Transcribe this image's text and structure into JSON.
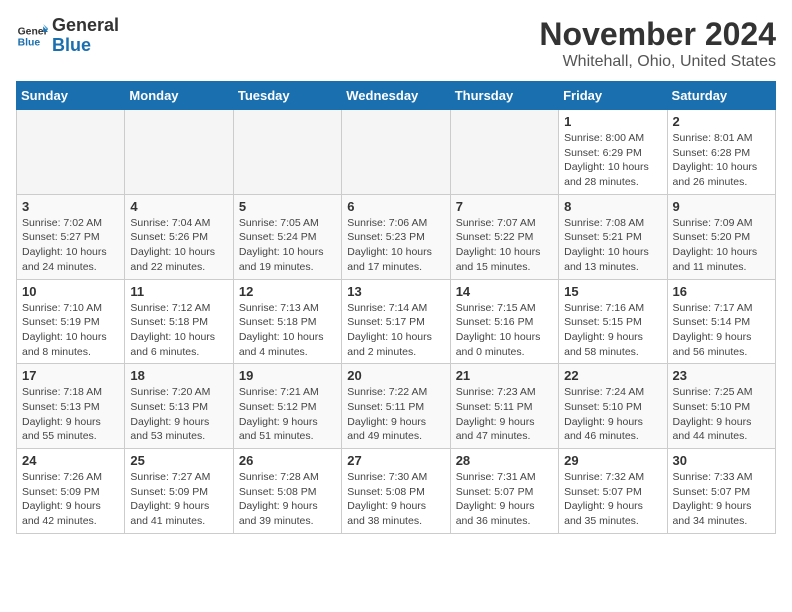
{
  "header": {
    "logo_general": "General",
    "logo_blue": "Blue",
    "month_title": "November 2024",
    "location": "Whitehall, Ohio, United States"
  },
  "weekdays": [
    "Sunday",
    "Monday",
    "Tuesday",
    "Wednesday",
    "Thursday",
    "Friday",
    "Saturday"
  ],
  "weeks": [
    [
      {
        "day": "",
        "info": ""
      },
      {
        "day": "",
        "info": ""
      },
      {
        "day": "",
        "info": ""
      },
      {
        "day": "",
        "info": ""
      },
      {
        "day": "",
        "info": ""
      },
      {
        "day": "1",
        "info": "Sunrise: 8:00 AM\nSunset: 6:29 PM\nDaylight: 10 hours and 28 minutes."
      },
      {
        "day": "2",
        "info": "Sunrise: 8:01 AM\nSunset: 6:28 PM\nDaylight: 10 hours and 26 minutes."
      }
    ],
    [
      {
        "day": "3",
        "info": "Sunrise: 7:02 AM\nSunset: 5:27 PM\nDaylight: 10 hours and 24 minutes."
      },
      {
        "day": "4",
        "info": "Sunrise: 7:04 AM\nSunset: 5:26 PM\nDaylight: 10 hours and 22 minutes."
      },
      {
        "day": "5",
        "info": "Sunrise: 7:05 AM\nSunset: 5:24 PM\nDaylight: 10 hours and 19 minutes."
      },
      {
        "day": "6",
        "info": "Sunrise: 7:06 AM\nSunset: 5:23 PM\nDaylight: 10 hours and 17 minutes."
      },
      {
        "day": "7",
        "info": "Sunrise: 7:07 AM\nSunset: 5:22 PM\nDaylight: 10 hours and 15 minutes."
      },
      {
        "day": "8",
        "info": "Sunrise: 7:08 AM\nSunset: 5:21 PM\nDaylight: 10 hours and 13 minutes."
      },
      {
        "day": "9",
        "info": "Sunrise: 7:09 AM\nSunset: 5:20 PM\nDaylight: 10 hours and 11 minutes."
      }
    ],
    [
      {
        "day": "10",
        "info": "Sunrise: 7:10 AM\nSunset: 5:19 PM\nDaylight: 10 hours and 8 minutes."
      },
      {
        "day": "11",
        "info": "Sunrise: 7:12 AM\nSunset: 5:18 PM\nDaylight: 10 hours and 6 minutes."
      },
      {
        "day": "12",
        "info": "Sunrise: 7:13 AM\nSunset: 5:18 PM\nDaylight: 10 hours and 4 minutes."
      },
      {
        "day": "13",
        "info": "Sunrise: 7:14 AM\nSunset: 5:17 PM\nDaylight: 10 hours and 2 minutes."
      },
      {
        "day": "14",
        "info": "Sunrise: 7:15 AM\nSunset: 5:16 PM\nDaylight: 10 hours and 0 minutes."
      },
      {
        "day": "15",
        "info": "Sunrise: 7:16 AM\nSunset: 5:15 PM\nDaylight: 9 hours and 58 minutes."
      },
      {
        "day": "16",
        "info": "Sunrise: 7:17 AM\nSunset: 5:14 PM\nDaylight: 9 hours and 56 minutes."
      }
    ],
    [
      {
        "day": "17",
        "info": "Sunrise: 7:18 AM\nSunset: 5:13 PM\nDaylight: 9 hours and 55 minutes."
      },
      {
        "day": "18",
        "info": "Sunrise: 7:20 AM\nSunset: 5:13 PM\nDaylight: 9 hours and 53 minutes."
      },
      {
        "day": "19",
        "info": "Sunrise: 7:21 AM\nSunset: 5:12 PM\nDaylight: 9 hours and 51 minutes."
      },
      {
        "day": "20",
        "info": "Sunrise: 7:22 AM\nSunset: 5:11 PM\nDaylight: 9 hours and 49 minutes."
      },
      {
        "day": "21",
        "info": "Sunrise: 7:23 AM\nSunset: 5:11 PM\nDaylight: 9 hours and 47 minutes."
      },
      {
        "day": "22",
        "info": "Sunrise: 7:24 AM\nSunset: 5:10 PM\nDaylight: 9 hours and 46 minutes."
      },
      {
        "day": "23",
        "info": "Sunrise: 7:25 AM\nSunset: 5:10 PM\nDaylight: 9 hours and 44 minutes."
      }
    ],
    [
      {
        "day": "24",
        "info": "Sunrise: 7:26 AM\nSunset: 5:09 PM\nDaylight: 9 hours and 42 minutes."
      },
      {
        "day": "25",
        "info": "Sunrise: 7:27 AM\nSunset: 5:09 PM\nDaylight: 9 hours and 41 minutes."
      },
      {
        "day": "26",
        "info": "Sunrise: 7:28 AM\nSunset: 5:08 PM\nDaylight: 9 hours and 39 minutes."
      },
      {
        "day": "27",
        "info": "Sunrise: 7:30 AM\nSunset: 5:08 PM\nDaylight: 9 hours and 38 minutes."
      },
      {
        "day": "28",
        "info": "Sunrise: 7:31 AM\nSunset: 5:07 PM\nDaylight: 9 hours and 36 minutes."
      },
      {
        "day": "29",
        "info": "Sunrise: 7:32 AM\nSunset: 5:07 PM\nDaylight: 9 hours and 35 minutes."
      },
      {
        "day": "30",
        "info": "Sunrise: 7:33 AM\nSunset: 5:07 PM\nDaylight: 9 hours and 34 minutes."
      }
    ]
  ]
}
